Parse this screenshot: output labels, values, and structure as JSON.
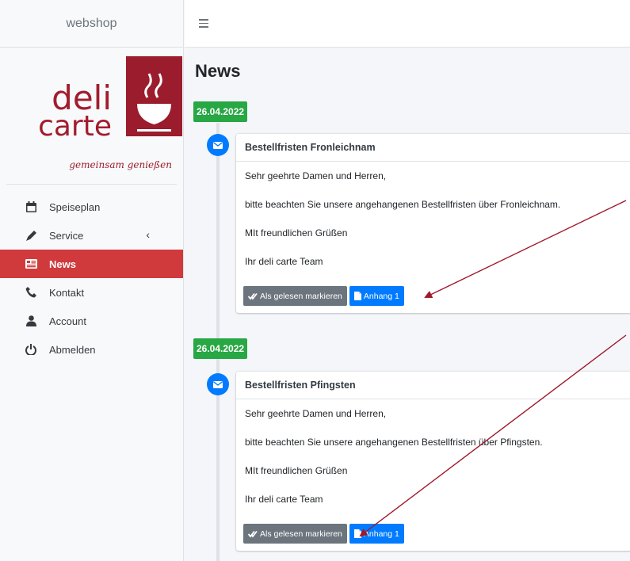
{
  "brand": {
    "name": "webshop"
  },
  "logo": {
    "line1": "deli",
    "line2": "carte",
    "tagline": "gemeinsam genießen"
  },
  "nav": {
    "items": [
      {
        "label": "Speiseplan"
      },
      {
        "label": "Service"
      },
      {
        "label": "News"
      },
      {
        "label": "Kontakt"
      },
      {
        "label": "Account"
      },
      {
        "label": "Abmelden"
      }
    ],
    "active": "News"
  },
  "page": {
    "title": "News"
  },
  "news": [
    {
      "date": "26.04.2022",
      "title": "Bestellfristen Fronleichnam",
      "lines": [
        "Sehr geehrte Damen und Herren,",
        "bitte beachten Sie unsere angehangenen Bestellfristen über Fronleichnam.",
        "MIt freundlichen Grüßen",
        "Ihr deli carte Team"
      ],
      "mark_read_label": "Als gelesen markieren",
      "attachment_label": "Anhang 1"
    },
    {
      "date": "26.04.2022",
      "title": "Bestellfristen Pfingsten",
      "lines": [
        "Sehr geehrte Damen und Herren,",
        "bitte beachten Sie unsere angehangenen Bestellfristen über Pfingsten.",
        "MIt freundlichen Grüßen",
        "Ihr deli carte Team"
      ],
      "mark_read_label": "Als gelesen markieren",
      "attachment_label": "Anhang 1"
    }
  ],
  "colors": {
    "brand_red": "#9b1c2c",
    "active_nav": "#d13a3d",
    "date_badge": "#28a745",
    "primary": "#007bff",
    "annotation_arrow": "#a0182b"
  }
}
